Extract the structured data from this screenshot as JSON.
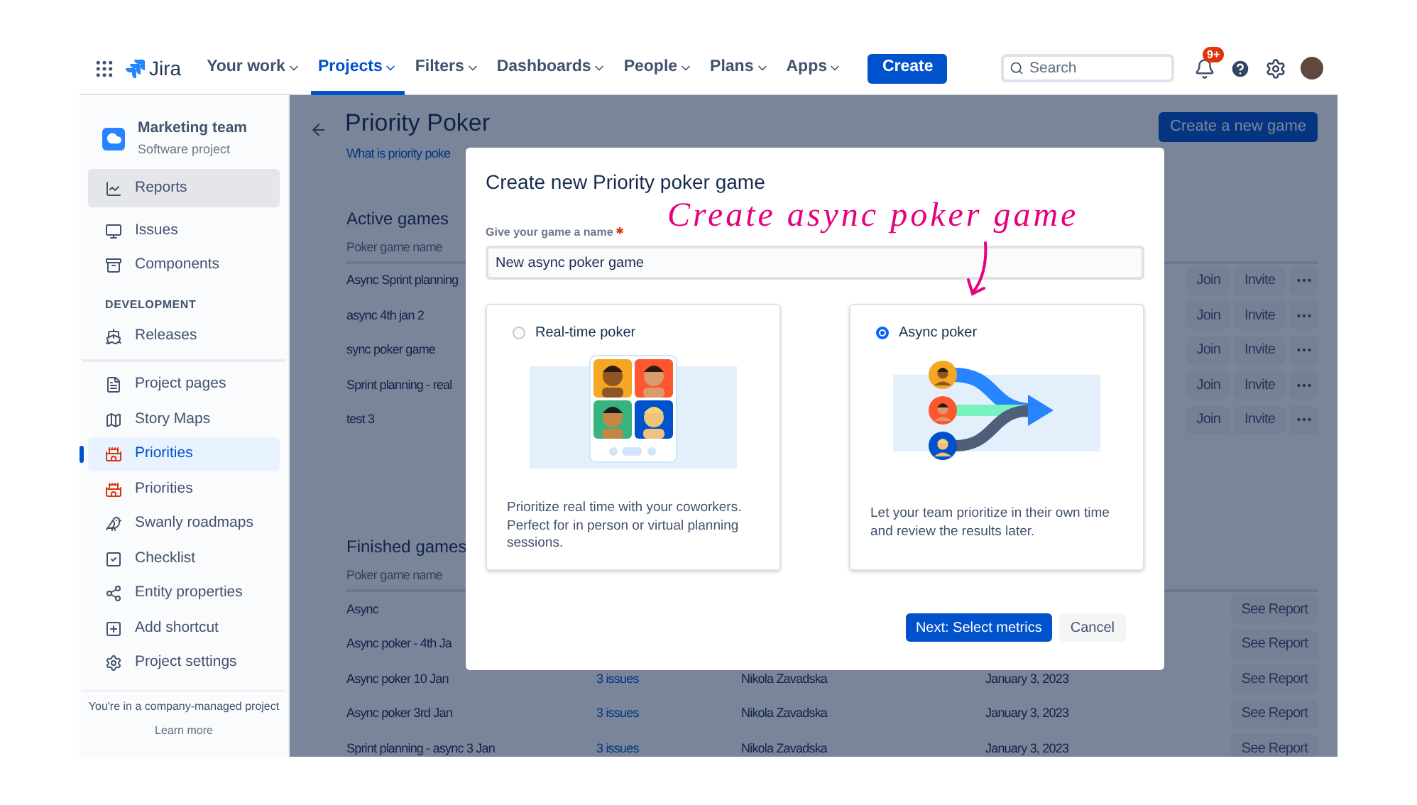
{
  "nav": {
    "logo": "Jira",
    "items": [
      {
        "label": "Your work",
        "selected": false
      },
      {
        "label": "Projects",
        "selected": true
      },
      {
        "label": "Filters",
        "selected": false
      },
      {
        "label": "Dashboards",
        "selected": false
      },
      {
        "label": "People",
        "selected": false
      },
      {
        "label": "Plans",
        "selected": false
      },
      {
        "label": "Apps",
        "selected": false
      }
    ],
    "create": "Create",
    "search": {
      "placeholder": "Search"
    },
    "badge": "9+"
  },
  "sidebar": {
    "project": {
      "name": "Marketing team",
      "type": "Software project"
    },
    "groups": [
      {
        "items": [
          {
            "label": "Reports",
            "selected": false,
            "hovered": true
          },
          {
            "label": "Issues",
            "selected": false,
            "hovered": false
          },
          {
            "label": "Components",
            "selected": false,
            "hovered": false
          }
        ]
      },
      {
        "heading": "DEVELOPMENT",
        "items": [
          {
            "label": "Releases",
            "selected": false,
            "hovered": false
          }
        ]
      },
      {
        "items": [
          {
            "label": "Project pages",
            "selected": false,
            "hovered": false
          },
          {
            "label": "Story Maps",
            "selected": false,
            "hovered": false
          },
          {
            "label": "Priorities",
            "selected": true,
            "hovered": false
          },
          {
            "label": "Priorities",
            "selected": false,
            "hovered": false
          },
          {
            "label": "Swanly roadmaps",
            "selected": false,
            "hovered": false
          },
          {
            "label": "Checklist",
            "selected": false,
            "hovered": false
          },
          {
            "label": "Entity properties",
            "selected": false,
            "hovered": false
          },
          {
            "label": "Add shortcut",
            "selected": false,
            "hovered": false
          },
          {
            "label": "Project settings",
            "selected": false,
            "hovered": false
          }
        ]
      }
    ],
    "footer": {
      "text": "You're in a company-managed project",
      "link": "Learn more"
    }
  },
  "page": {
    "title": "Priority Poker",
    "link": "What is priority poke",
    "create_button": "Create a new game",
    "active_games": {
      "heading": "Active games",
      "columns": [
        "Poker game name"
      ],
      "rows": [
        {
          "name": "Async Sprint planning",
          "actions": [
            "Join",
            "Invite"
          ]
        },
        {
          "name": "async 4th jan 2",
          "actions": [
            "Join",
            "Invite"
          ]
        },
        {
          "name": "sync poker game",
          "actions": [
            "Join",
            "Invite"
          ]
        },
        {
          "name": "Sprint planning - real",
          "actions": [
            "Join",
            "Invite"
          ]
        },
        {
          "name": "test 3",
          "actions": [
            "Join",
            "Invite"
          ]
        }
      ]
    },
    "finished_games": {
      "heading": "Finished games",
      "columns": [
        "Poker game name"
      ],
      "rows": [
        {
          "name": "Async",
          "action": "See Report"
        },
        {
          "name": "Async poker - 4th Ja",
          "action": "See Report"
        },
        {
          "name": "Async poker 10 Jan",
          "issues": "3 issues",
          "owner": "Nikola Zavadska",
          "date": "January 3, 2023",
          "action": "See Report"
        },
        {
          "name": "Async poker 3rd Jan",
          "issues": "3 issues",
          "owner": "Nikola Zavadska",
          "date": "January 3, 2023",
          "action": "See Report"
        },
        {
          "name": "Sprint planning - async 3 Jan",
          "issues": "3 issues",
          "owner": "Nikola Zavadska",
          "date": "January 3, 2023",
          "action": "See Report"
        }
      ]
    }
  },
  "modal": {
    "title": "Create new Priority poker game",
    "field": {
      "label": "Give your game a name",
      "required": true,
      "value": "New async poker game"
    },
    "annotation": "Create async poker game",
    "options": [
      {
        "kind": "realtime",
        "label": "Real-time poker",
        "selected": false,
        "description": "Prioritize real time with your coworkers. Perfect for in person or virtual planning sessions."
      },
      {
        "kind": "async",
        "label": "Async poker",
        "selected": true,
        "description": "Let your team prioritize in their own time and review the results later."
      }
    ],
    "primary_button": "Next: Select metrics",
    "secondary_button": "Cancel"
  }
}
